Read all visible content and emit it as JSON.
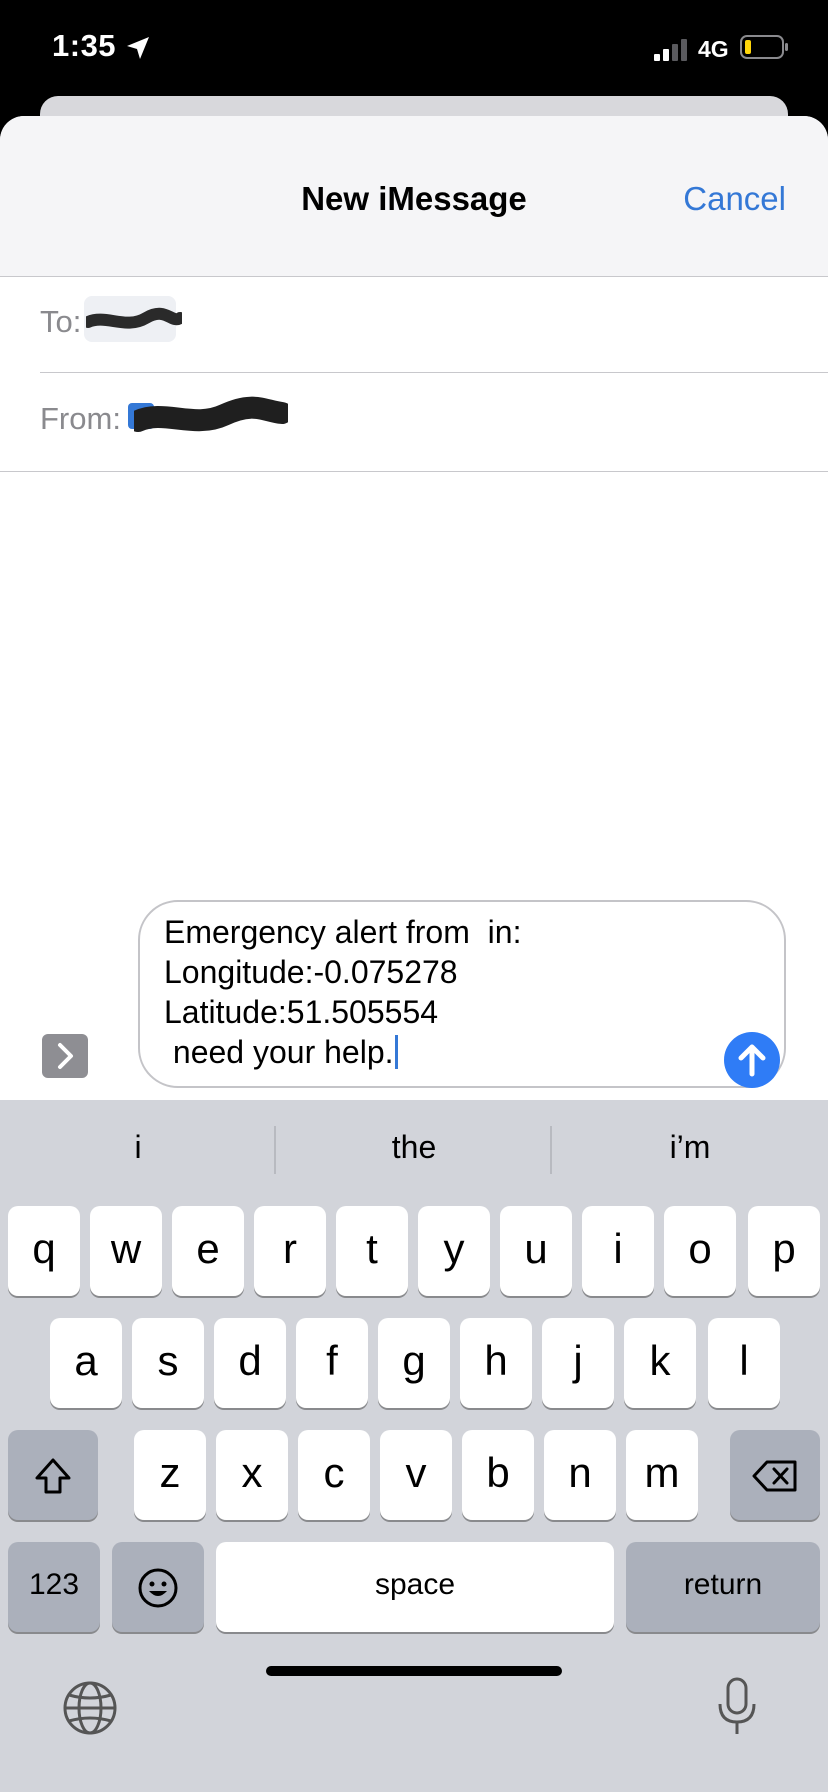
{
  "status_bar": {
    "time": "1:35",
    "network": "4G"
  },
  "nav": {
    "title": "New iMessage",
    "cancel_label": "Cancel"
  },
  "to_field": {
    "label": "To:"
  },
  "from_field": {
    "label": "From:"
  },
  "compose": {
    "lines": [
      "Emergency alert from  in:",
      "Longitude:-0.075278",
      "Latitude:51.505554",
      " need your help."
    ]
  },
  "keyboard": {
    "suggestions": [
      "i",
      "the",
      "i’m"
    ],
    "row1": [
      "q",
      "w",
      "e",
      "r",
      "t",
      "y",
      "u",
      "i",
      "o",
      "p"
    ],
    "row2": [
      "a",
      "s",
      "d",
      "f",
      "g",
      "h",
      "j",
      "k",
      "l"
    ],
    "row3": [
      "z",
      "x",
      "c",
      "v",
      "b",
      "n",
      "m"
    ],
    "numbers_label": "123",
    "space_label": "space",
    "return_label": "return"
  },
  "colors": {
    "accent": "#3478d6",
    "send_button": "#2f7cf6",
    "keyboard_bg": "#d2d4da"
  },
  "icons": [
    "location-arrow-icon",
    "signal-icon",
    "battery-icon",
    "chevron-right-icon",
    "send-arrow-icon",
    "shift-icon",
    "backspace-icon",
    "emoji-icon",
    "globe-icon",
    "microphone-icon"
  ]
}
